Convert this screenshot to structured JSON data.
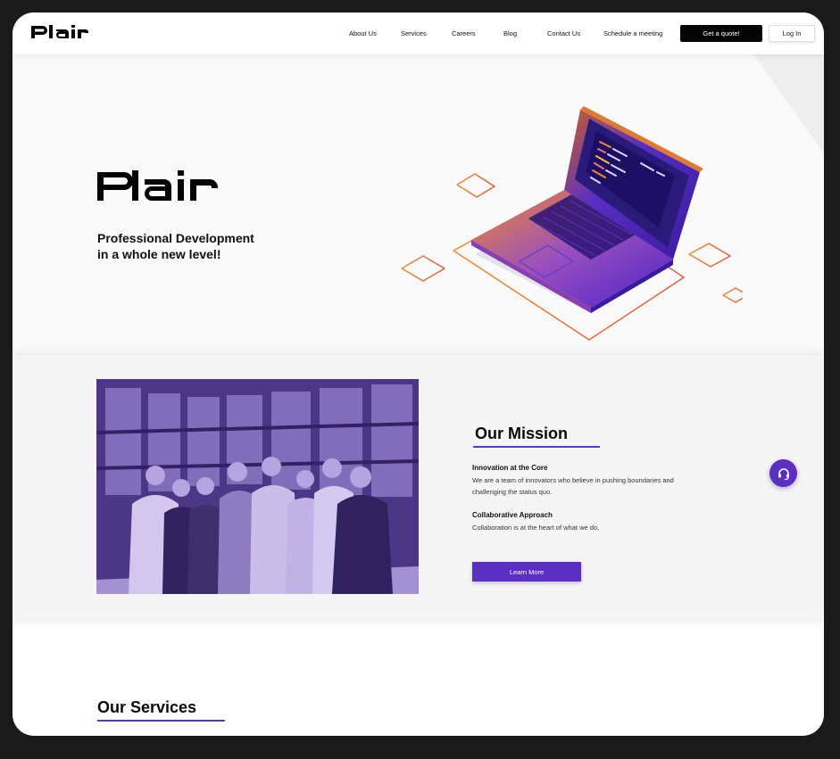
{
  "brand": {
    "name": "Plair"
  },
  "nav": {
    "items": [
      "About Us",
      "Services",
      "Careers",
      "Blog",
      "Contact Us",
      "Schedule a meeting"
    ],
    "quote_label": "Get a quote!",
    "login_label": "Log In"
  },
  "hero": {
    "tagline_line1": "Professional Development",
    "tagline_line2": "in a whole new level!"
  },
  "mission": {
    "title": "Our Mission",
    "items": [
      {
        "title": "Innovation at the Core",
        "text": "We are a team of innovators who believe in pushing boundaries and challenging the status quo."
      },
      {
        "title": "Collaborative Approach",
        "text": "Collaboration is at the heart of what we do."
      }
    ],
    "button_label": "Learn More"
  },
  "services": {
    "title": "Our Services"
  },
  "colors": {
    "accent": "#5a2fc2",
    "laptop_gradient_start": "#f08a2c",
    "laptop_gradient_end": "#4b22c7",
    "header_button": "#050505"
  },
  "icons": {
    "chat": "headset-icon"
  }
}
